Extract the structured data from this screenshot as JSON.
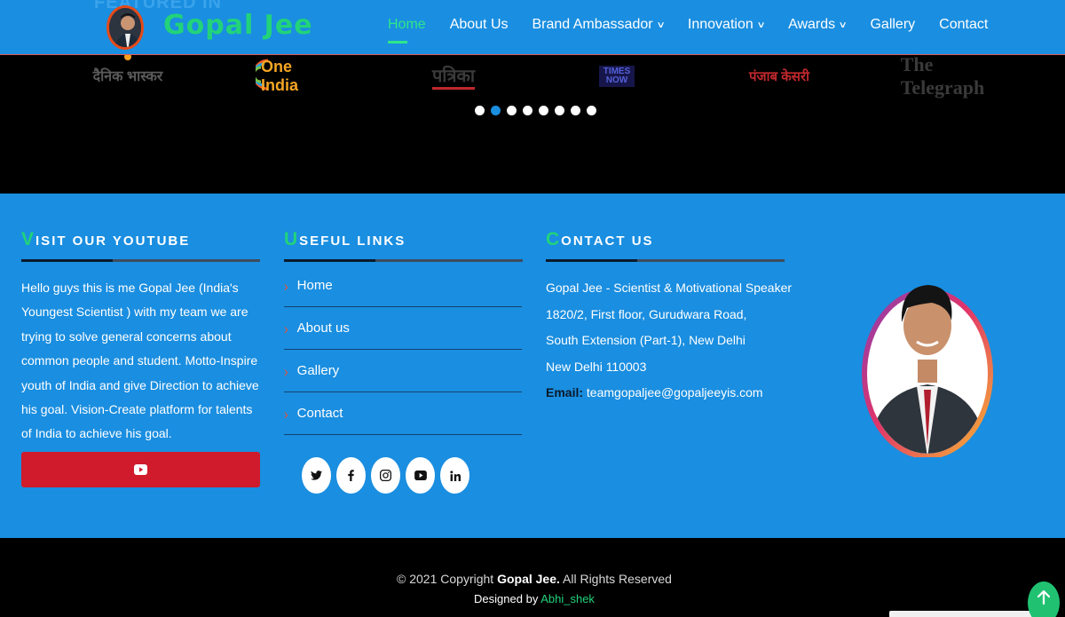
{
  "header": {
    "ghost_text": "FEATURED IN",
    "logo_text": "Gopal Jee",
    "nav": [
      {
        "label": "Home",
        "active": true,
        "dropdown": false
      },
      {
        "label": "About Us",
        "active": false,
        "dropdown": false
      },
      {
        "label": "Brand Ambassador",
        "active": false,
        "dropdown": true
      },
      {
        "label": "Innovation",
        "active": false,
        "dropdown": true
      },
      {
        "label": "Awards",
        "active": false,
        "dropdown": true
      },
      {
        "label": "Gallery",
        "active": false,
        "dropdown": false
      },
      {
        "label": "Contact",
        "active": false,
        "dropdown": false
      }
    ]
  },
  "featured": {
    "logos": [
      "दैनिक भास्कर",
      "One India",
      "पत्रिका",
      "TIMES NOW",
      "पंजाब केसरी",
      "The Telegraph"
    ],
    "dots_count": 8,
    "active_dot": 1
  },
  "footer": {
    "youtube": {
      "title_cap": "V",
      "title_rest": "ISIT OUR YOUTUBE",
      "text": "Hello guys this is me Gopal Jee (India's Youngest Scientist ) with my team we are trying to solve general concerns about common people and student. Motto-Inspire youth of India and give Direction to achieve his goal. Vision-Create platform for talents of India to achieve his goal."
    },
    "useful_links": {
      "title_cap": "U",
      "title_rest": "SEFUL LINKS",
      "items": [
        "Home",
        "About us",
        "Gallery",
        "Contact"
      ]
    },
    "socials": [
      "twitter-icon",
      "facebook-icon",
      "instagram-icon",
      "youtube-icon",
      "linkedin-icon"
    ],
    "contact": {
      "title_cap": "C",
      "title_rest": "ONTACT US",
      "line1": "Gopal Jee - Scientist & Motivational Speaker",
      "line2": "1820/2, First floor, Gurudwara Road,",
      "line3": "South Extension (Part-1), New Delhi",
      "line4": "New Delhi 110003",
      "email_label": "Email:",
      "email": "teamgopaljee@gopaljeeyis.com"
    }
  },
  "bottom": {
    "copy_prefix": "© 2021 Copyright ",
    "copy_name": "Gopal Jee.",
    "copy_suffix": " All Rights Reserved",
    "designed_prefix": "Designed by ",
    "designed_author": "Abhi_shek"
  },
  "colors": {
    "primary_blue": "#1a8ee0",
    "accent_green": "#22d37a",
    "youtube_red": "#cf1b2b"
  }
}
